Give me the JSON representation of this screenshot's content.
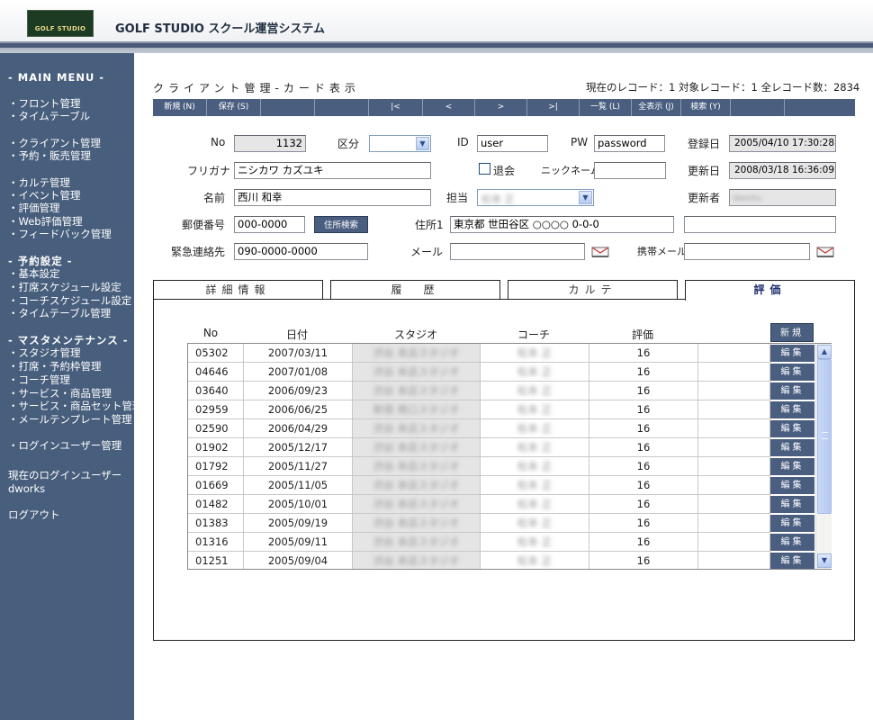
{
  "header": {
    "logo_text": "GOLF STUDIO",
    "app_title": "GOLF STUDIO スクール運営システム"
  },
  "sidebar": {
    "main_menu": "- MAIN MENU -",
    "items_front": [
      "・フロント管理",
      "・タイムテーブル"
    ],
    "items_client": [
      "・クライアント管理",
      "・予約・販売管理"
    ],
    "items_karte": [
      "・カルテ管理",
      "・イベント管理",
      "・評価管理",
      "・Web評価管理",
      "・フィードバック管理"
    ],
    "yoyaku_head": "- 予約設定 -",
    "items_yoyaku": [
      "・基本設定",
      "・打席スケジュール設定",
      "・コーチスケジュール設定",
      "・タイムテーブル管理"
    ],
    "master_head": "- マスタメンテナンス -",
    "items_master": [
      "・スタジオ管理",
      "・打席・予約枠管理",
      "・コーチ管理",
      "・サービス・商品管理",
      "・サービス・商品セット管理",
      "・メールテンプレート管理"
    ],
    "login_user_mgmt": "・ログインユーザー管理",
    "current_user_label": "現在のログインユーザー",
    "current_user": "dworks",
    "logout": "ログアウト"
  },
  "page": {
    "title": "クライアント管理-カード表示",
    "record_info": "現在のレコード：1  対象レコード：1  全レコード数：2834"
  },
  "toolbar": {
    "new": "新規 (N)",
    "save": "保存 (S)",
    "first": "|<",
    "prev": "<",
    "next": ">",
    "last": ">|",
    "list": "一覧 (L)",
    "show_all": "全表示 (J)",
    "search": "検索 (Y)"
  },
  "form": {
    "no_label": "No",
    "no_value": "1132",
    "kubun_label": "区分",
    "id_label": "ID",
    "id_value": "user",
    "pw_label": "PW",
    "pw_value": "password",
    "registered_label": "登録日",
    "registered_value": "2005/04/10 17:30:28",
    "furigana_label": "フリガナ",
    "furigana_value": "ニシカワ カズユキ",
    "taikai_label": "退会",
    "nickname_label": "ニックネーム",
    "nickname_value": "",
    "updated_label": "更新日",
    "updated_value": "2008/03/18 16:36:09",
    "name_label": "名前",
    "name_value": "西川 和幸",
    "tanto_label": "担当",
    "tanto_value": "松本 正",
    "updater_label": "更新者",
    "updater_value": "dworks",
    "zip_label": "郵便番号",
    "zip_value": "000-0000",
    "zip_search": "住所検索",
    "address1_label": "住所1",
    "address1_value": "東京都 世田谷区 ○○○○ 0-0-0",
    "address2_value": "",
    "emergency_label": "緊急連絡先",
    "emergency_value": "090-0000-0000",
    "mail_label": "メール",
    "mail_value": "",
    "mobile_mail_label": "携帯メール",
    "mobile_mail_value": ""
  },
  "tabs": [
    "詳細情報",
    "履　歴",
    "カルテ",
    "評価"
  ],
  "grid": {
    "headers": [
      "No",
      "日付",
      "スタジオ",
      "コーチ",
      "評価"
    ],
    "new_button": "新規",
    "edit_label": "編集",
    "rows": [
      {
        "no": "05302",
        "date": "2007/03/11",
        "studio": "渋谷 本店スタジオ",
        "coach": "松本 正",
        "score": "16"
      },
      {
        "no": "04646",
        "date": "2007/01/08",
        "studio": "渋谷 本店スタジオ",
        "coach": "松本 正",
        "score": "16"
      },
      {
        "no": "03640",
        "date": "2006/09/23",
        "studio": "渋谷 本店スタジオ",
        "coach": "松本 正",
        "score": "16"
      },
      {
        "no": "02959",
        "date": "2006/06/25",
        "studio": "新宿 南口スタジオ",
        "coach": "松本 正",
        "score": "16"
      },
      {
        "no": "02590",
        "date": "2006/04/29",
        "studio": "渋谷 本店スタジオ",
        "coach": "松本 正",
        "score": "16"
      },
      {
        "no": "01902",
        "date": "2005/12/17",
        "studio": "渋谷 本店スタジオ",
        "coach": "松本 正",
        "score": "16"
      },
      {
        "no": "01792",
        "date": "2005/11/27",
        "studio": "渋谷 本店スタジオ",
        "coach": "松本 正",
        "score": "16"
      },
      {
        "no": "01669",
        "date": "2005/11/05",
        "studio": "渋谷 本店スタジオ",
        "coach": "松本 正",
        "score": "16"
      },
      {
        "no": "01482",
        "date": "2005/10/01",
        "studio": "渋谷 本店スタジオ",
        "coach": "松本 正",
        "score": "16"
      },
      {
        "no": "01383",
        "date": "2005/09/19",
        "studio": "渋谷 本店スタジオ",
        "coach": "松本 正",
        "score": "16"
      },
      {
        "no": "01316",
        "date": "2005/09/11",
        "studio": "渋谷 本店スタジオ",
        "coach": "松本 正",
        "score": "16"
      },
      {
        "no": "01251",
        "date": "2005/09/04",
        "studio": "渋谷 本店スタジオ",
        "coach": "松本 正",
        "score": "16"
      }
    ]
  },
  "icons": {
    "mail": "mail-icon",
    "dropdown": "chevron-down-icon",
    "scroll_up": "chevron-up-icon",
    "scroll_down": "chevron-down-icon"
  },
  "colors": {
    "sidebar_bg": "#475e7c",
    "button_bg": "#4a5e80",
    "readonly_bg": "#e6e6e6"
  }
}
